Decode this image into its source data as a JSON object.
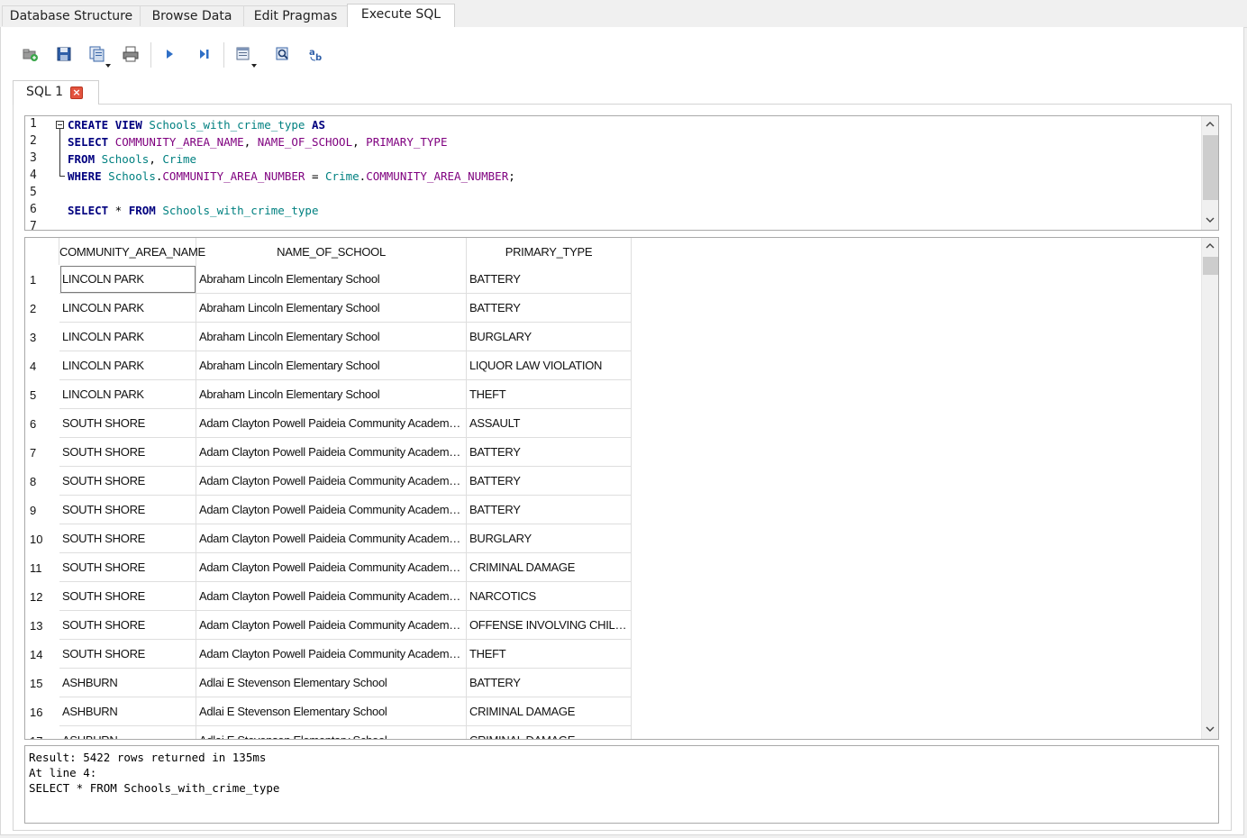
{
  "tabs": [
    {
      "label": "Database Structure"
    },
    {
      "label": "Browse Data"
    },
    {
      "label": "Edit Pragmas"
    },
    {
      "label": "Execute SQL"
    }
  ],
  "toolbar": {
    "icons": [
      "open-tab-icon",
      "open-sql-file-icon",
      "save-sql-file-icon",
      "print-icon",
      "execute-all-icon",
      "execute-line-icon",
      "save-results-icon",
      "find-icon",
      "find-replace-icon"
    ]
  },
  "editor_tab": {
    "label": "SQL 1"
  },
  "editor": {
    "line_numbers": [
      "1",
      "2",
      "3",
      "4",
      "5",
      "6",
      "7"
    ]
  },
  "colors": {
    "keyword": "#00007f",
    "table": "#008080",
    "column": "#7f007f",
    "close": "#e3533e"
  },
  "results": {
    "columns": [
      "COMMUNITY_AREA_NAME",
      "NAME_OF_SCHOOL",
      "PRIMARY_TYPE"
    ],
    "rows": [
      {
        "n": "1",
        "c1": "LINCOLN PARK",
        "c2": "Abraham Lincoln Elementary School",
        "c3": "BATTERY"
      },
      {
        "n": "2",
        "c1": "LINCOLN PARK",
        "c2": "Abraham Lincoln Elementary School",
        "c3": "BATTERY"
      },
      {
        "n": "3",
        "c1": "LINCOLN PARK",
        "c2": "Abraham Lincoln Elementary School",
        "c3": "BURGLARY"
      },
      {
        "n": "4",
        "c1": "LINCOLN PARK",
        "c2": "Abraham Lincoln Elementary School",
        "c3": "LIQUOR LAW VIOLATION"
      },
      {
        "n": "5",
        "c1": "LINCOLN PARK",
        "c2": "Abraham Lincoln Elementary School",
        "c3": "THEFT"
      },
      {
        "n": "6",
        "c1": "SOUTH SHORE",
        "c2": "Adam Clayton Powell Paideia Community Academy Eleme...",
        "c3": "ASSAULT"
      },
      {
        "n": "7",
        "c1": "SOUTH SHORE",
        "c2": "Adam Clayton Powell Paideia Community Academy Eleme...",
        "c3": "BATTERY"
      },
      {
        "n": "8",
        "c1": "SOUTH SHORE",
        "c2": "Adam Clayton Powell Paideia Community Academy Eleme...",
        "c3": "BATTERY"
      },
      {
        "n": "9",
        "c1": "SOUTH SHORE",
        "c2": "Adam Clayton Powell Paideia Community Academy Eleme...",
        "c3": "BATTERY"
      },
      {
        "n": "10",
        "c1": "SOUTH SHORE",
        "c2": "Adam Clayton Powell Paideia Community Academy Eleme...",
        "c3": "BURGLARY"
      },
      {
        "n": "11",
        "c1": "SOUTH SHORE",
        "c2": "Adam Clayton Powell Paideia Community Academy Eleme...",
        "c3": "CRIMINAL DAMAGE"
      },
      {
        "n": "12",
        "c1": "SOUTH SHORE",
        "c2": "Adam Clayton Powell Paideia Community Academy Eleme...",
        "c3": "NARCOTICS"
      },
      {
        "n": "13",
        "c1": "SOUTH SHORE",
        "c2": "Adam Clayton Powell Paideia Community Academy Eleme...",
        "c3": "OFFENSE INVOLVING CHILDREN"
      },
      {
        "n": "14",
        "c1": "SOUTH SHORE",
        "c2": "Adam Clayton Powell Paideia Community Academy Eleme...",
        "c3": "THEFT"
      },
      {
        "n": "15",
        "c1": "ASHBURN",
        "c2": "Adlai E Stevenson Elementary School",
        "c3": "BATTERY"
      },
      {
        "n": "16",
        "c1": "ASHBURN",
        "c2": "Adlai E Stevenson Elementary School",
        "c3": "CRIMINAL DAMAGE"
      },
      {
        "n": "17",
        "c1": "ASHBURN",
        "c2": "Adlai E Stevenson Elementary School",
        "c3": "CRIMINAL DAMAGE"
      }
    ]
  },
  "message": {
    "line1": "Result: 5422 rows returned in 135ms",
    "line2": "At line 4:",
    "line3": "SELECT * FROM Schools_with_crime_type"
  }
}
